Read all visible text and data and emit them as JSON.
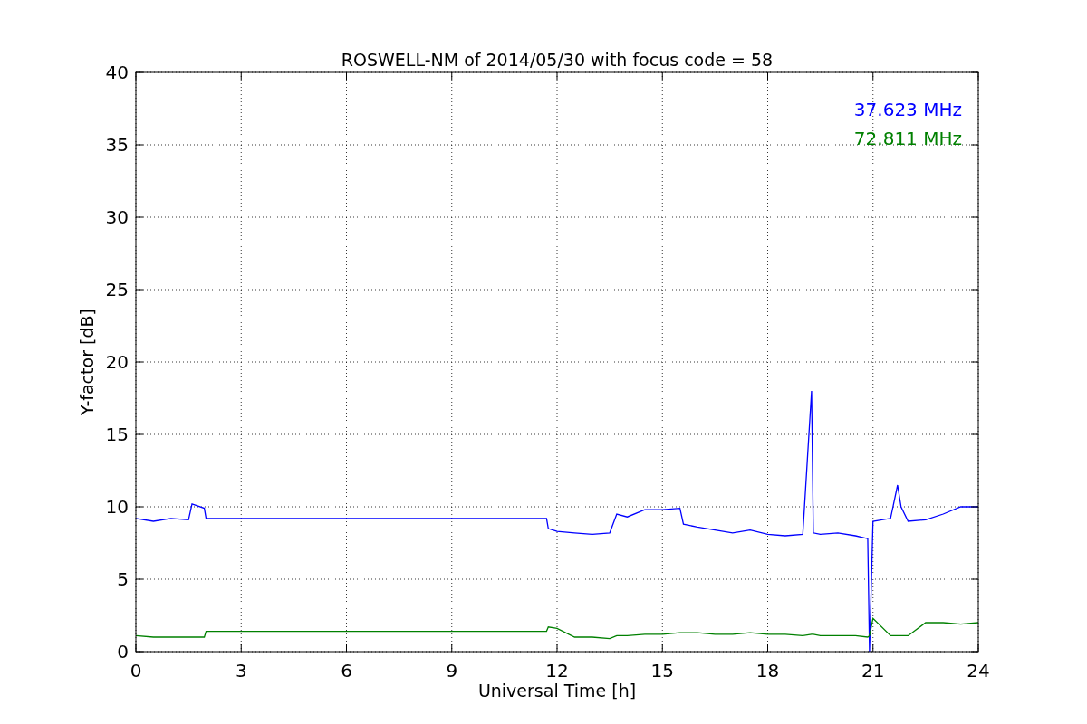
{
  "figure": {
    "chart_data": {
      "type": "line",
      "title": "ROSWELL-NM of 2014/05/30 with focus code = 58",
      "xlabel": "Universal Time [h]",
      "ylabel": "Y-factor [dB]",
      "x": [
        0,
        0.5,
        1,
        1.5,
        1.6,
        1.95,
        2,
        3,
        6,
        9,
        11.7,
        11.75,
        12,
        12.5,
        13,
        13.5,
        13.7,
        14,
        14.5,
        15,
        15.5,
        15.6,
        16,
        16.5,
        17,
        17.5,
        18,
        18.5,
        19,
        19.25,
        19.3,
        19.5,
        20,
        20.5,
        20.85,
        20.9,
        21,
        21.5,
        21.7,
        21.8,
        22,
        22.5,
        23,
        23.5,
        24
      ],
      "series": [
        {
          "name": "37.623 MHz",
          "color": "#0000ff",
          "values": [
            9.2,
            9.0,
            9.2,
            9.1,
            10.2,
            9.9,
            9.2,
            9.2,
            9.2,
            9.2,
            9.2,
            8.5,
            8.3,
            8.2,
            8.1,
            8.2,
            9.5,
            9.3,
            9.8,
            9.8,
            9.9,
            8.8,
            8.6,
            8.4,
            8.2,
            8.4,
            8.1,
            8.0,
            8.1,
            18,
            8.2,
            8.1,
            8.2,
            8.0,
            7.8,
            0,
            9.0,
            9.2,
            11.5,
            10,
            9.0,
            9.1,
            9.5,
            10,
            10
          ]
        },
        {
          "name": "72.811 MHz",
          "color": "#008000",
          "values": [
            1.1,
            1.0,
            1.0,
            1.0,
            1.0,
            1.0,
            1.4,
            1.4,
            1.4,
            1.4,
            1.4,
            1.7,
            1.6,
            1.0,
            1.0,
            0.9,
            1.1,
            1.1,
            1.2,
            1.2,
            1.3,
            1.3,
            1.3,
            1.2,
            1.2,
            1.3,
            1.2,
            1.2,
            1.1,
            1.2,
            1.2,
            1.1,
            1.1,
            1.1,
            1.0,
            1.1,
            2.3,
            1.1,
            1.1,
            1.1,
            1.1,
            2.0,
            2.0,
            1.9,
            2.0
          ]
        }
      ],
      "xlim": [
        0,
        24
      ],
      "ylim": [
        0,
        40
      ],
      "xticks": [
        0,
        3,
        6,
        9,
        12,
        15,
        18,
        21,
        24
      ],
      "yticks": [
        0,
        5,
        10,
        15,
        20,
        25,
        30,
        35,
        40
      ],
      "grid": true
    }
  }
}
